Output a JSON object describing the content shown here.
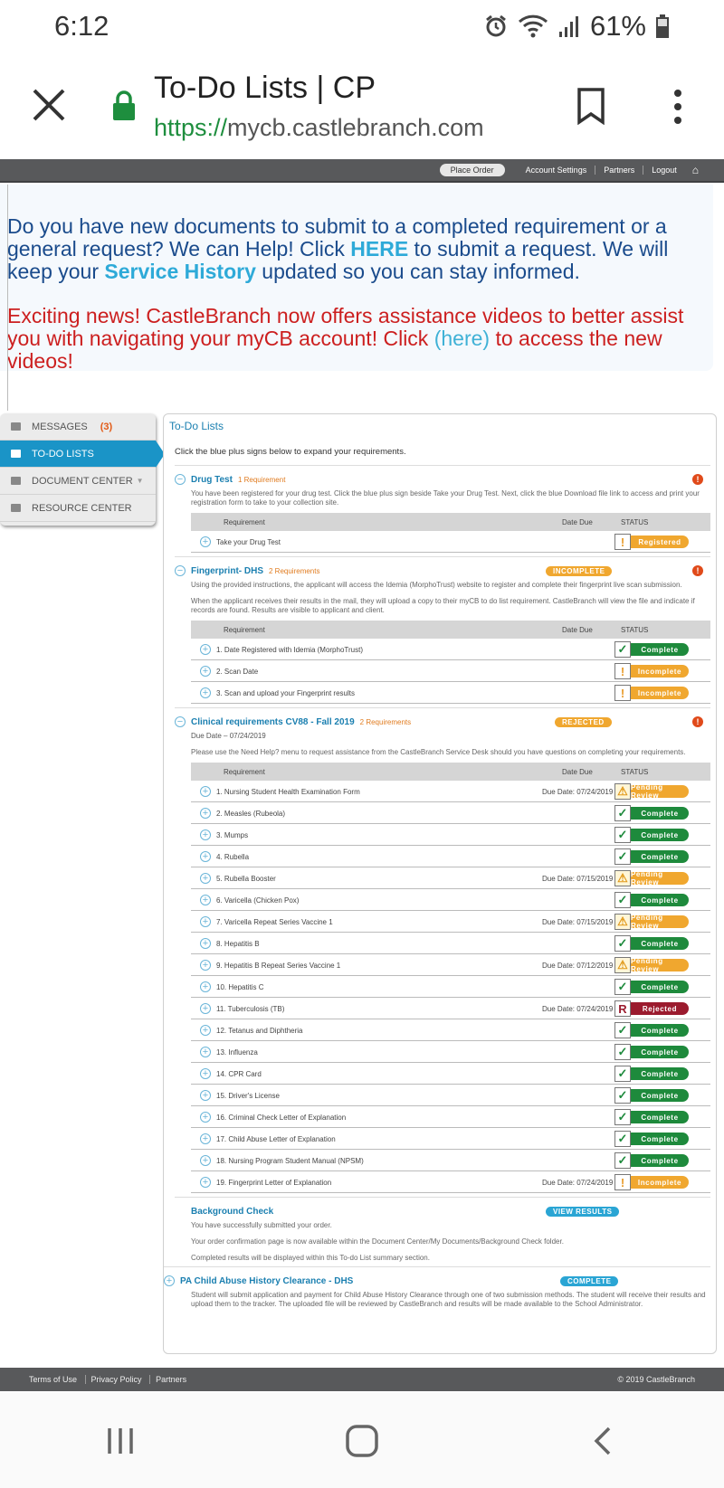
{
  "status_bar": {
    "time": "6:12",
    "battery": "61%"
  },
  "browser": {
    "title": "To-Do Lists | CP",
    "url_scheme": "https://",
    "url_host": "mycb.castlebranch.com"
  },
  "topnav": {
    "place_order": "Place Order",
    "links": [
      "Account Settings",
      "Partners",
      "Logout"
    ]
  },
  "announcements": {
    "a1_p1": "Do you have new documents to submit to a completed requirement or a general request? We can Help! Click ",
    "a1_link": "HERE",
    "a1_p2": " to submit a request. We will keep your ",
    "a1_link2": "Service History",
    "a1_p3": " updated so you can stay informed.",
    "a2_p1": "Exciting news! CastleBranch now offers assistance videos to better assist you with navigating your myCB account! Click ",
    "a2_link": "(here)",
    "a2_p2": " to access the new videos!"
  },
  "sidebar": {
    "messages": "MESSAGES",
    "messages_count": "(3)",
    "todo": "TO-DO LISTS",
    "document_center": "DOCUMENT CENTER",
    "resource_center": "RESOURCE CENTER"
  },
  "panel": {
    "title": "To-Do Lists",
    "intro": "Click the blue plus signs below to expand your requirements.",
    "col_requirement": "Requirement",
    "col_date": "Date Due",
    "col_status": "STATUS"
  },
  "drug": {
    "name": "Drug Test",
    "count": "1 Requirement",
    "desc": "You have been registered for your drug test. Click the blue plus sign beside Take your Drug Test. Next, click the blue Download file link to access and print your registration form to take to your collection site.",
    "row1": "Take your Drug Test",
    "row1_status": "Registered"
  },
  "fingerprint": {
    "name": "Fingerprint- DHS",
    "count": "2 Requirements",
    "badge": "INCOMPLETE",
    "desc1": "Using the provided instructions, the applicant will access the Idemia (MorphoTrust) website to register and complete their fingerprint live scan submission.",
    "desc2": "When the applicant receives their results in the mail, they will upload a copy to their myCB to do list requirement. CastleBranch will view the file and indicate if records are found. Results are visible to applicant and client.",
    "rows": [
      {
        "label": "1. Date Registered with Idemia (MorphoTrust)",
        "status": "Complete"
      },
      {
        "label": "2. Scan Date",
        "status": "Incomplete"
      },
      {
        "label": "3. Scan and upload your Fingerprint results",
        "status": "Incomplete"
      }
    ]
  },
  "clinical": {
    "name": "Clinical requirements CV88 - Fall 2019",
    "count": "2 Requirements",
    "badge": "REJECTED",
    "due": "Due Date – 07/24/2019",
    "desc": "Please use the Need Help? menu to request assistance from the CastleBranch Service Desk should you have questions on completing your requirements.",
    "rows": [
      {
        "label": "1. Nursing Student Health Examination Form",
        "date": "Due Date: 07/24/2019",
        "status": "Pending Review"
      },
      {
        "label": "2. Measles (Rubeola)",
        "date": "",
        "status": "Complete"
      },
      {
        "label": "3. Mumps",
        "date": "",
        "status": "Complete"
      },
      {
        "label": "4. Rubella",
        "date": "",
        "status": "Complete"
      },
      {
        "label": "5. Rubella Booster",
        "date": "Due Date: 07/15/2019",
        "status": "Pending Review"
      },
      {
        "label": "6. Varicella (Chicken Pox)",
        "date": "",
        "status": "Complete"
      },
      {
        "label": "7. Varicella Repeat Series Vaccine 1",
        "date": "Due Date: 07/15/2019",
        "status": "Pending Review"
      },
      {
        "label": "8. Hepatitis B",
        "date": "",
        "status": "Complete"
      },
      {
        "label": "9. Hepatitis B Repeat Series Vaccine 1",
        "date": "Due Date: 07/12/2019",
        "status": "Pending Review"
      },
      {
        "label": "10. Hepatitis C",
        "date": "",
        "status": "Complete"
      },
      {
        "label": "11. Tuberculosis (TB)",
        "date": "Due Date: 07/24/2019",
        "status": "Rejected"
      },
      {
        "label": "12. Tetanus and Diphtheria",
        "date": "",
        "status": "Complete"
      },
      {
        "label": "13. Influenza",
        "date": "",
        "status": "Complete"
      },
      {
        "label": "14. CPR Card",
        "date": "",
        "status": "Complete"
      },
      {
        "label": "15. Driver's License",
        "date": "",
        "status": "Complete"
      },
      {
        "label": "16. Criminal Check Letter of Explanation",
        "date": "",
        "status": "Complete"
      },
      {
        "label": "17. Child Abuse Letter of Explanation",
        "date": "",
        "status": "Complete"
      },
      {
        "label": "18. Nursing Program Student Manual (NPSM)",
        "date": "",
        "status": "Complete"
      },
      {
        "label": "19. Fingerprint Letter of Explanation",
        "date": "Due Date: 07/24/2019",
        "status": "Incomplete"
      }
    ]
  },
  "background": {
    "name": "Background Check",
    "badge": "VIEW RESULTS",
    "d1": "You have successfully submitted your order.",
    "d2": "Your order confirmation page is now available within the Document Center/My Documents/Background Check folder.",
    "d3": "Completed results will be displayed within this To-do List summary section."
  },
  "pa": {
    "name": "PA Child Abuse History Clearance - DHS",
    "badge": "COMPLETE",
    "desc": "Student will submit application and payment for Child Abuse History Clearance through one of two submission methods. The student will receive their results and upload them to the tracker. The uploaded file will be reviewed by CastleBranch and results will be made available to the School Administrator."
  },
  "footer": {
    "links": [
      "Terms of Use",
      "Privacy Policy",
      "Partners"
    ],
    "copyright": "© 2019 CastleBranch"
  },
  "colors": {
    "accent": "#1a94c7",
    "complete": "#1e8a3c",
    "incomplete": "#f0a72f",
    "rejected": "#9b1b2e"
  }
}
